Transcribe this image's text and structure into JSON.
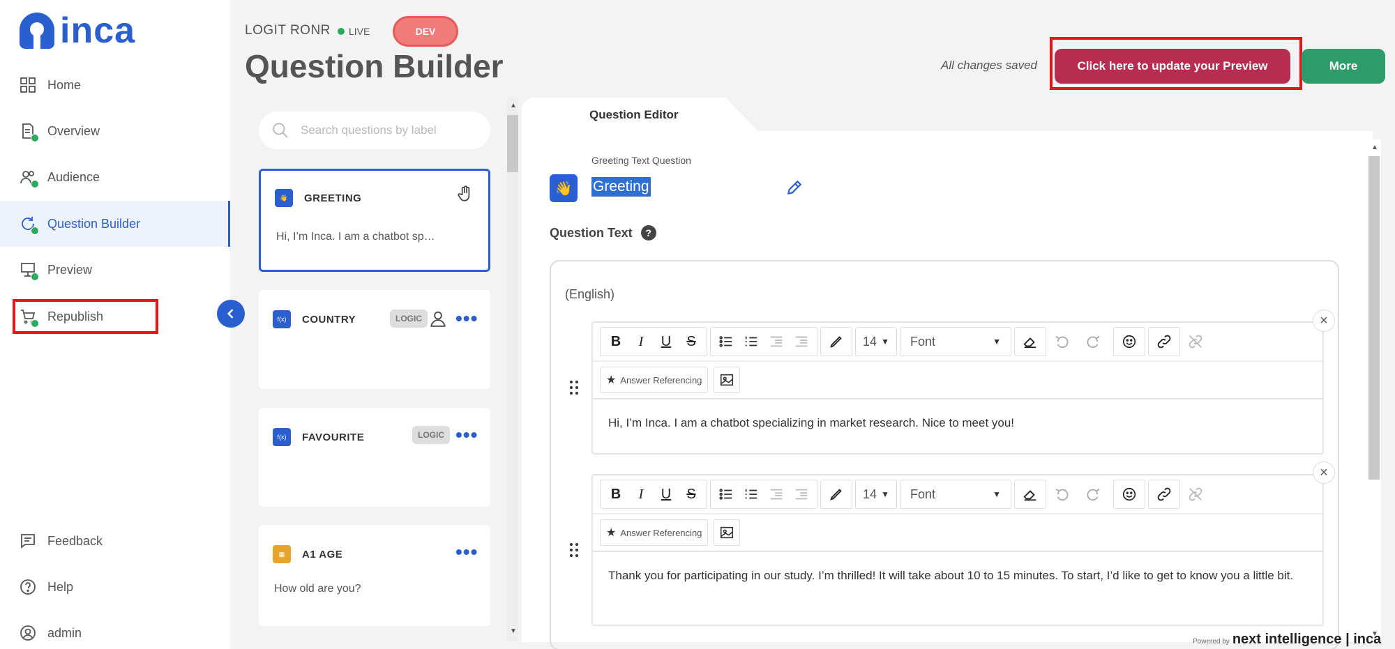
{
  "app": {
    "logo_text": "inca",
    "brand_color": "#2a5fcf"
  },
  "sidebar": {
    "items": [
      {
        "label": "Home",
        "icon": "grid-icon"
      },
      {
        "label": "Overview",
        "icon": "document-check-icon"
      },
      {
        "label": "Audience",
        "icon": "users-icon"
      },
      {
        "label": "Question Builder",
        "icon": "refresh-check-icon",
        "active": true
      },
      {
        "label": "Preview",
        "icon": "presentation-icon"
      },
      {
        "label": "Republish",
        "icon": "cart-icon"
      }
    ],
    "bottom_items": [
      {
        "label": "Feedback",
        "icon": "feedback-icon"
      },
      {
        "label": "Help",
        "icon": "help-icon"
      },
      {
        "label": "admin",
        "icon": "user-circle-icon"
      }
    ]
  },
  "header": {
    "project": "LOGIT RONR",
    "status": "LIVE",
    "env_badge": "DEV",
    "title": "Question Builder",
    "saved_text": "All changes saved",
    "preview_button": "Click here to update your Preview",
    "more_button": "More"
  },
  "question_list": {
    "search_placeholder": "Search questions by label",
    "questions": [
      {
        "label": "GREETING",
        "text": "Hi, I’m Inca. I am a chatbot sp…",
        "selected": true
      },
      {
        "label": "COUNTRY",
        "badge": "LOGIC",
        "text": ""
      },
      {
        "label": "FAVOURITE",
        "badge": "LOGIC",
        "text": ""
      },
      {
        "label": "A1 AGE",
        "text": "How old are you?"
      }
    ],
    "menu_glyph": "•••"
  },
  "editor": {
    "tab": "Question Editor",
    "question_type": "Greeting Text Question",
    "question_name": "Greeting",
    "question_text_label": "Question Text",
    "help_glyph": "?",
    "language": "(English)",
    "toolbar": {
      "font_size": "14",
      "font": "Font",
      "answer_referencing": "Answer Referencing"
    },
    "messages": [
      "Hi, I’m Inca. I am a chatbot specializing in market research. Nice to meet you!",
      "Thank you for participating in our study. I’m thrilled! It will take about 10 to 15 minutes. To start, I’d like to get to know you a little bit."
    ]
  },
  "footer": {
    "powered_by": "Powered by",
    "brand": "next intelligence | inca"
  }
}
